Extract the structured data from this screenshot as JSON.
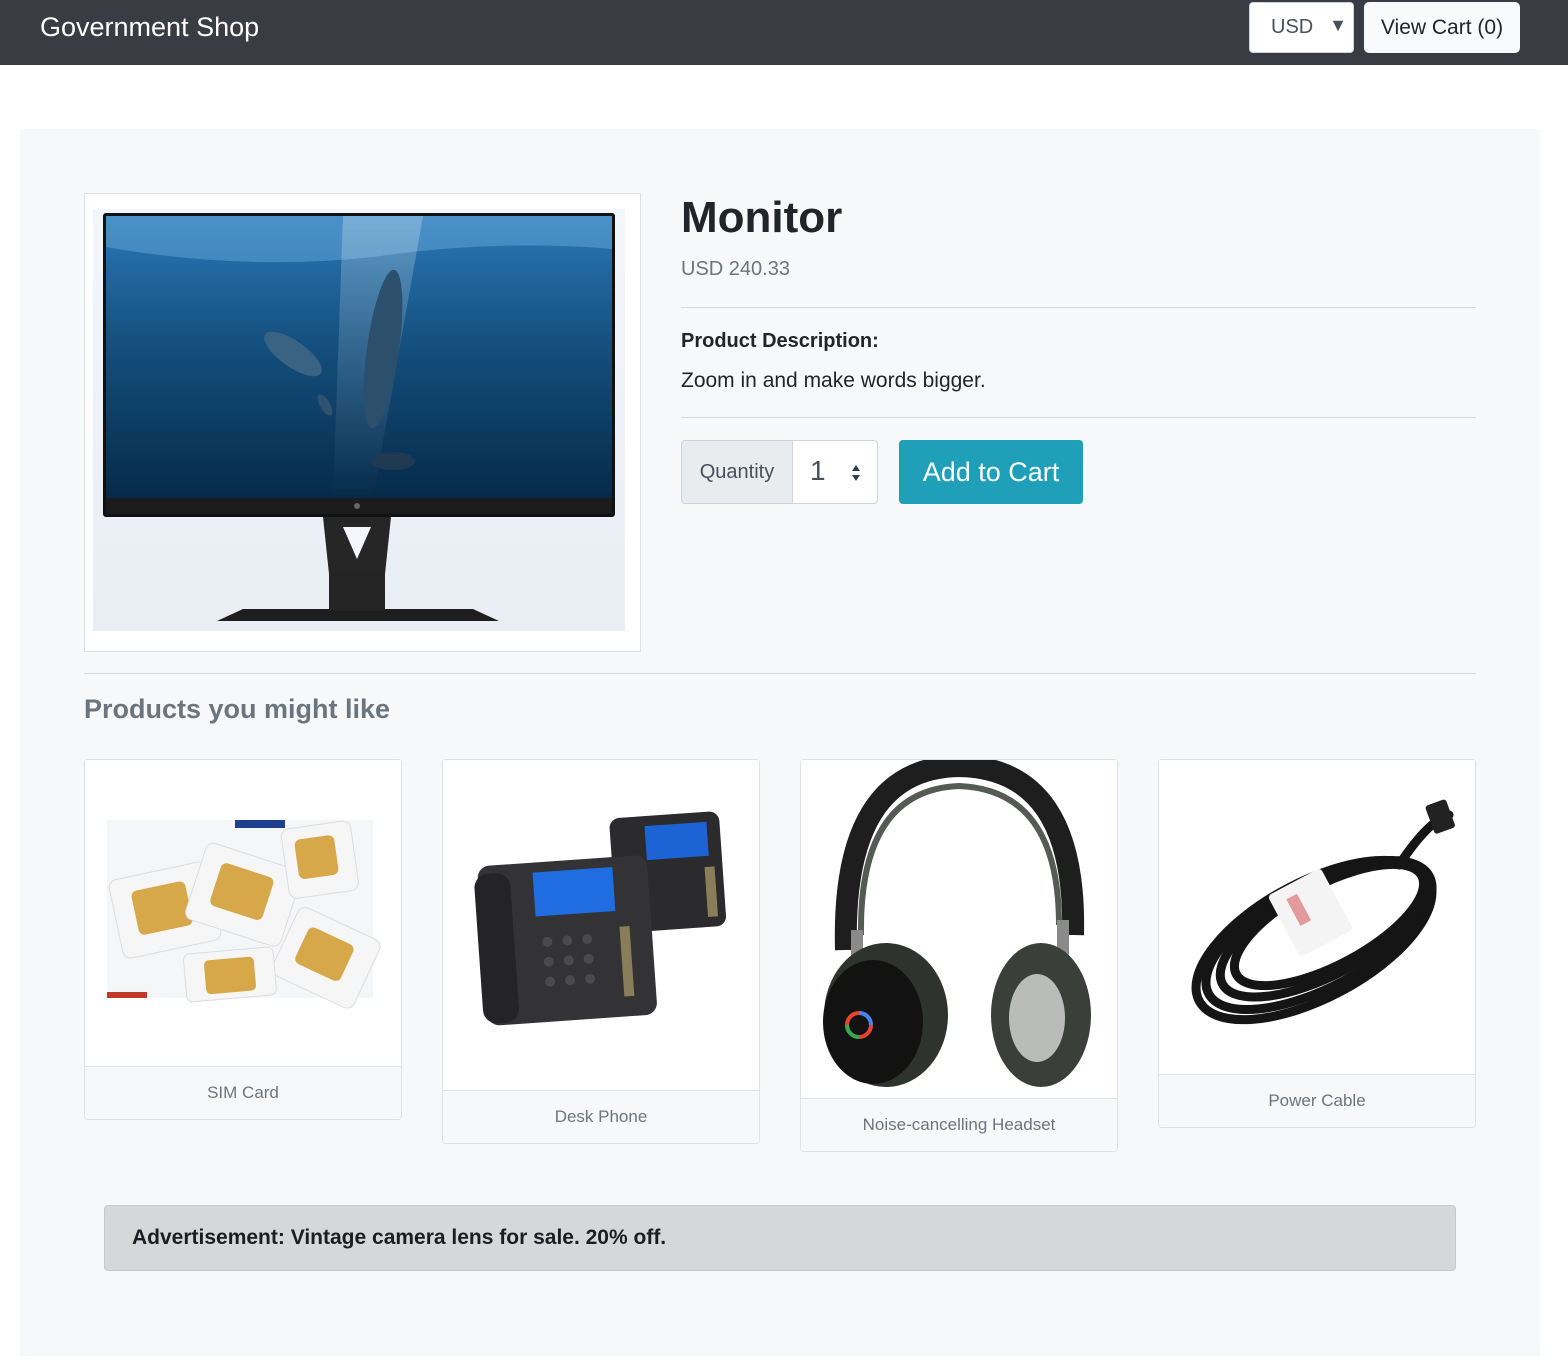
{
  "header": {
    "brand": "Government Shop",
    "currency": "USD",
    "cart_label": "View Cart (0)"
  },
  "product": {
    "name": "Monitor",
    "price": "USD 240.33",
    "description_label": "Product Description:",
    "description": "Zoom in and make words bigger.",
    "quantity_label": "Quantity",
    "quantity_value": "1",
    "add_to_cart_label": "Add to Cart"
  },
  "recommendations": {
    "title": "Products you might like",
    "items": [
      {
        "name": "SIM Card"
      },
      {
        "name": "Desk Phone"
      },
      {
        "name": "Noise-cancelling Headset"
      },
      {
        "name": "Power Cable"
      }
    ]
  },
  "ad": {
    "text": "Advertisement: Vintage camera lens for sale. 20% off."
  },
  "colors": {
    "navbar": "#393c42",
    "accent_button": "#1f9fb8",
    "panel_background": "#f7f8fa"
  }
}
